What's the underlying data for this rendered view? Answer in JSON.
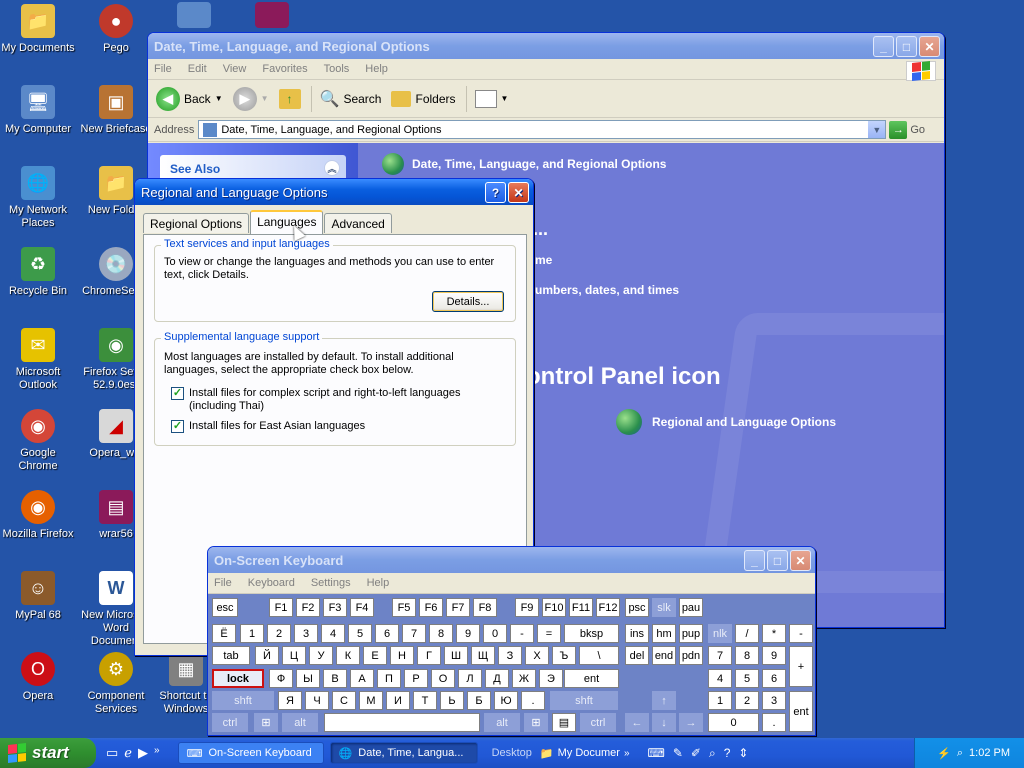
{
  "desktop": {
    "icons": [
      {
        "label": "My Documents",
        "glyph": "📁",
        "color": "#e8c048"
      },
      {
        "label": "My Computer",
        "glyph": "🖥",
        "color": "#5b89c9"
      },
      {
        "label": "My Network\nPlaces",
        "glyph": "🌐",
        "color": "#4a8fd0"
      },
      {
        "label": "Recycle Bin",
        "glyph": "♻",
        "color": "#3d9b4a"
      },
      {
        "label": "Microsoft\nOutlook",
        "glyph": "✉",
        "color": "#e6c200"
      },
      {
        "label": "Google Chrome",
        "glyph": "◉",
        "color": "#d44638"
      },
      {
        "label": "Mozilla Firefox",
        "glyph": "◉",
        "color": "#e66000"
      },
      {
        "label": "MyPal 68",
        "glyph": "☺",
        "color": "#8b5a2b"
      },
      {
        "label": "Opera",
        "glyph": "O",
        "color": "#cc0f16"
      },
      {
        "label": "Pego",
        "glyph": "●",
        "color": "#c0392b"
      },
      {
        "label": "New Briefcase",
        "glyph": "▣",
        "color": "#b87333"
      },
      {
        "label": "New Folder",
        "glyph": "📁",
        "color": "#e8c048"
      },
      {
        "label": "ChromeSetup",
        "glyph": "💿",
        "color": "#9aa8c0"
      },
      {
        "label": "Firefox Setup\n52.9.0esr",
        "glyph": "◉",
        "color": "#3c8f3c"
      },
      {
        "label": "Opera_win",
        "glyph": "◢",
        "color": "#d8d8d8"
      },
      {
        "label": "wrar56",
        "glyph": "▤",
        "color": "#8b1a5a"
      },
      {
        "label": "New Microsoft\nWord Document",
        "glyph": "W",
        "color": "#2b5797"
      },
      {
        "label": "Component\nServices",
        "glyph": "⚙",
        "color": "#c8a000"
      },
      {
        "label": "Shortcut to\nWindows",
        "glyph": "▦",
        "color": "#808080"
      }
    ]
  },
  "control_panel": {
    "title": "Date, Time, Language, and Regional Options",
    "menu": [
      "File",
      "Edit",
      "View",
      "Favorites",
      "Tools",
      "Help"
    ],
    "toolbar": {
      "back": "Back",
      "search": "Search",
      "folders": "Folders"
    },
    "address_label": "Address",
    "address_value": "Date, Time, Language, and Regional Options",
    "go_label": "Go",
    "see_also": "See Also",
    "header": "Date, Time, Language, and Regional Options",
    "task_fragment_1": "...",
    "task_fragment_2": "me",
    "task_fragment_3": "umbers, dates, and times",
    "pick_icon_fragment": "ontrol Panel icon",
    "icon_label": "Regional and Language Options"
  },
  "regional_dialog": {
    "title": "Regional and Language Options",
    "tabs": [
      "Regional Options",
      "Languages",
      "Advanced"
    ],
    "active_tab": "Languages",
    "group1_title": "Text services and input languages",
    "group1_text": "To view or change the languages and methods you can use to enter text, click Details.",
    "details_button": "Details...",
    "group2_title": "Supplemental language support",
    "group2_text": "Most languages are installed by default. To install additional languages, select the appropriate check box below.",
    "checkbox1": "Install files for complex script and right-to-left languages (including Thai)",
    "checkbox2": "Install files for East Asian languages",
    "checkbox1_checked": true,
    "checkbox2_checked": true
  },
  "osk": {
    "title": "On-Screen Keyboard",
    "menu": [
      "File",
      "Keyboard",
      "Settings",
      "Help"
    ],
    "rows": {
      "fn": [
        "esc",
        "F1",
        "F2",
        "F3",
        "F4",
        "F5",
        "F6",
        "F7",
        "F8",
        "F9",
        "F10",
        "F11",
        "F12",
        "psc",
        "slk",
        "pau"
      ],
      "num": [
        "Ё",
        "1",
        "2",
        "3",
        "4",
        "5",
        "6",
        "7",
        "8",
        "9",
        "0",
        "-",
        "=",
        "bksp",
        "ins",
        "hm",
        "pup",
        "nlk",
        "/",
        "*",
        "-"
      ],
      "top": [
        "tab",
        "Й",
        "Ц",
        "У",
        "К",
        "Е",
        "Н",
        "Г",
        "Ш",
        "Щ",
        "З",
        "Х",
        "Ъ",
        "\\",
        "del",
        "end",
        "pdn",
        "7",
        "8",
        "9",
        "+"
      ],
      "home": [
        "lock",
        "Ф",
        "Ы",
        "В",
        "А",
        "П",
        "Р",
        "О",
        "Л",
        "Д",
        "Ж",
        "Э",
        "ent",
        "4",
        "5",
        "6"
      ],
      "shift": [
        "shft",
        "Я",
        "Ч",
        "С",
        "М",
        "И",
        "Т",
        "Ь",
        "Б",
        "Ю",
        ".",
        "shft",
        "↑",
        "1",
        "2",
        "3",
        "ent"
      ],
      "bottom": [
        "ctrl",
        "alt",
        "alt",
        "ctrl",
        "←",
        "↓",
        "→",
        "0",
        "."
      ]
    }
  },
  "taskbar": {
    "start": "start",
    "tasks": [
      "On-Screen Keyboard",
      "Date, Time, Langua..."
    ],
    "desktop_toolbar": "Desktop",
    "my_documents": "My Documer",
    "clock": "1:02 PM"
  },
  "colors": {
    "desktop": "#2454a8",
    "titlebar": "#0555d6",
    "keyboard_bg": "#6d83c6"
  }
}
